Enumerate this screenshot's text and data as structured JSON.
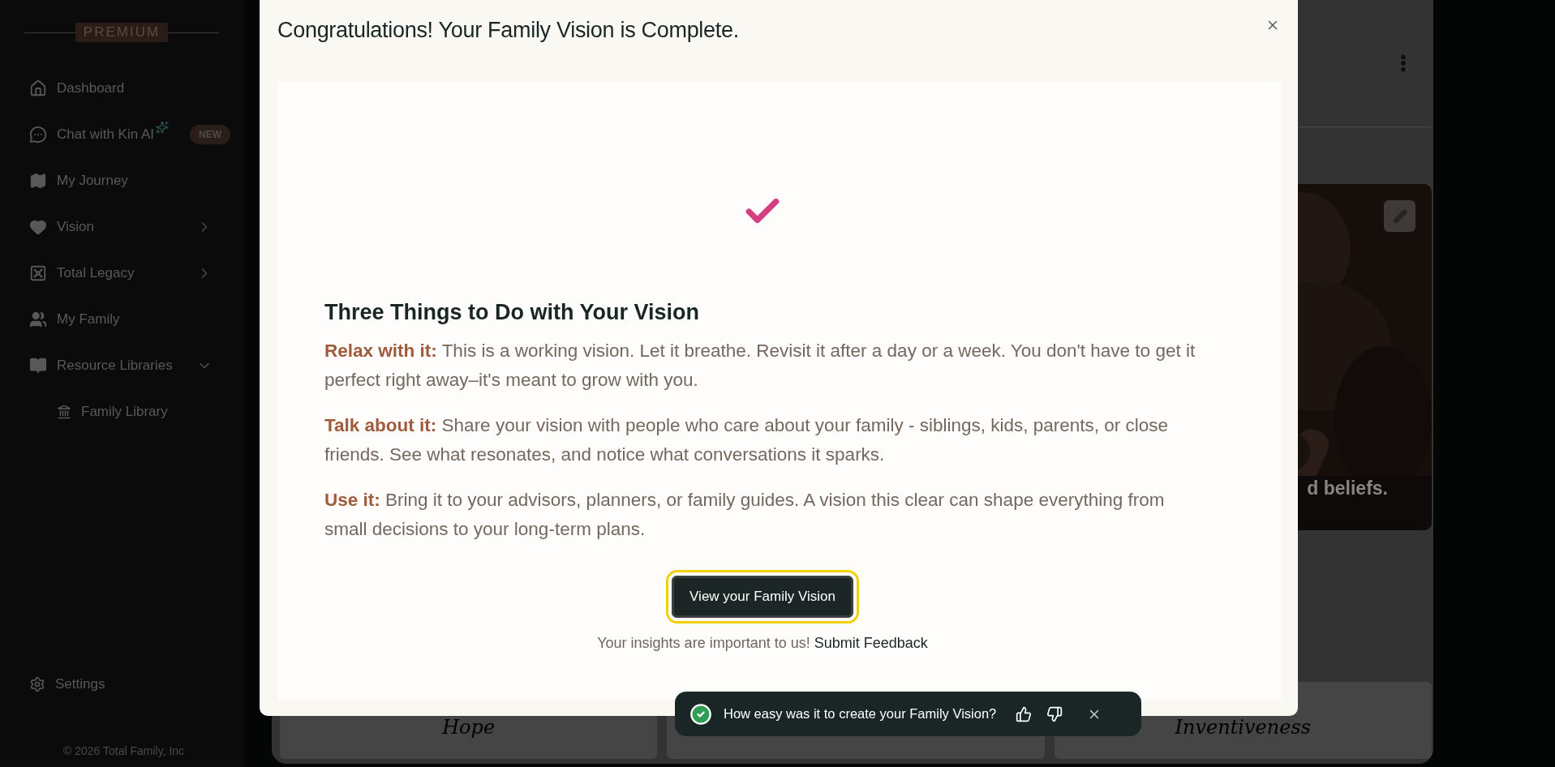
{
  "sidebar": {
    "badge": "PREMIUM",
    "items": [
      {
        "label": "Dashboard"
      },
      {
        "label": "Chat with Kin AI",
        "badge": "NEW"
      },
      {
        "label": "My Journey"
      },
      {
        "label": "Vision",
        "expanded": false
      },
      {
        "label": "Total Legacy",
        "expanded": false
      },
      {
        "label": "My Family"
      },
      {
        "label": "Resource Libraries",
        "expanded": true,
        "children": [
          {
            "label": "Family Library"
          }
        ]
      }
    ],
    "settings": "Settings",
    "footer": "© 2026 Total Family, Inc"
  },
  "background": {
    "card_text": "d beliefs.",
    "value_cards": [
      "Hope",
      "Inventiveness"
    ]
  },
  "modal": {
    "title": "Congratulations! Your Family Vision is Complete.",
    "heading": "Three Things to Do with Your Vision",
    "tips": [
      "**Relax with it:** This is a working vision. Let it breathe. Revisit it after a day or a week. You don't have to get it perfect right away–it's meant to grow with you.",
      "**Talk about it:** Share your vision with people who care about your family - siblings, kids, parents, or close friends. See what resonates, and notice what conversations it sparks.",
      "**Use it:** Bring it to your advisors, planners, or family guides. A vision this clear can shape everything from small decisions to your long-term plans."
    ],
    "button": "View your Family Vision",
    "feedback_text": "Your insights are important to us!",
    "feedback_link": "Submit Feedback"
  },
  "toast": {
    "text": "How easy was it to create your Family Vision?"
  }
}
